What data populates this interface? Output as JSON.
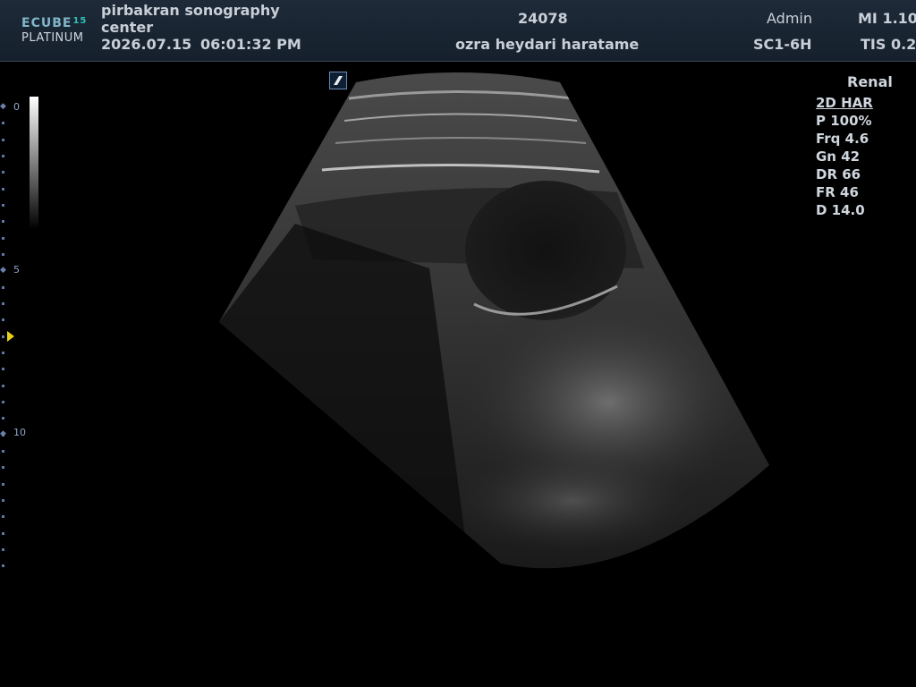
{
  "header": {
    "logo_line1": "ECUBE",
    "logo_model": "15",
    "logo_line2": "PLATINUM",
    "hospital": "pirbakran sonography center",
    "date": "2026.07.15",
    "time": "06:01:32  PM",
    "patient_id": "24078",
    "patient_name": "ozra heydari haratame",
    "operator": "Admin",
    "probe": "SC1-6H",
    "mi": "MI 1.10",
    "tis": "TIS 0.2"
  },
  "depth_scale": {
    "labels": [
      "0",
      "5",
      "10"
    ],
    "focus_icon": "focus-triangle-icon"
  },
  "params": {
    "preset": "Renal",
    "mode": "2D HAR",
    "power": "P 100%",
    "frequency": "Frq 4.6",
    "gain": "Gn 42",
    "dynamic_range": "DR 66",
    "frame_rate": "FR 46",
    "depth": "D 14.0"
  },
  "colors": {
    "header_bg": "#1a2532",
    "depth_marker": "#5f78a8",
    "focus_marker": "#e6d21a"
  },
  "icons": {
    "orientation": "orientation-marker-icon"
  }
}
